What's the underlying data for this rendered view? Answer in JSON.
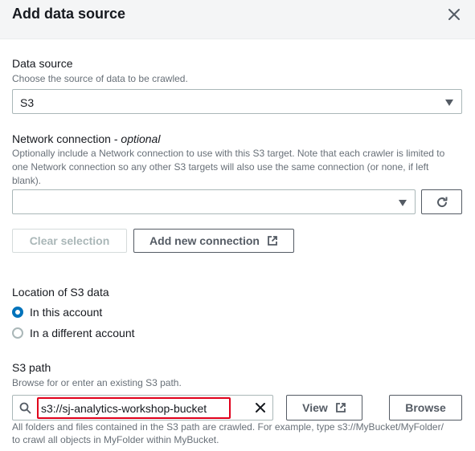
{
  "header": {
    "title": "Add data source"
  },
  "data_source": {
    "label": "Data source",
    "description": "Choose the source of data to be crawled.",
    "selected": "S3"
  },
  "network": {
    "label": "Network connection - ",
    "optional": "optional",
    "description_line1": "Optionally include a Network connection to use with this S3 target. Note that each crawler is limited to",
    "description_line2": "one Network connection so any other S3 targets will also use the same connection (or none, if left",
    "description_line3": "blank).",
    "selected": "",
    "clear_label": "Clear selection",
    "add_label": "Add new connection"
  },
  "location": {
    "label": "Location of S3 data",
    "options": [
      {
        "label": "In this account",
        "checked": true
      },
      {
        "label": "In a different account",
        "checked": false
      }
    ]
  },
  "s3path": {
    "label": "S3 path",
    "description": "Browse for or enter an existing S3 path.",
    "value": "s3://sj-analytics-workshop-bucket",
    "view_label": "View",
    "browse_label": "Browse",
    "hint_line1": "All folders and files contained in the S3 path are crawled. For example, type s3://MyBucket/MyFolder/",
    "hint_line2": "to crawl all objects in MyFolder within MyBucket."
  },
  "colors": {
    "accent": "#0073bb",
    "highlight": "#e0001b"
  }
}
